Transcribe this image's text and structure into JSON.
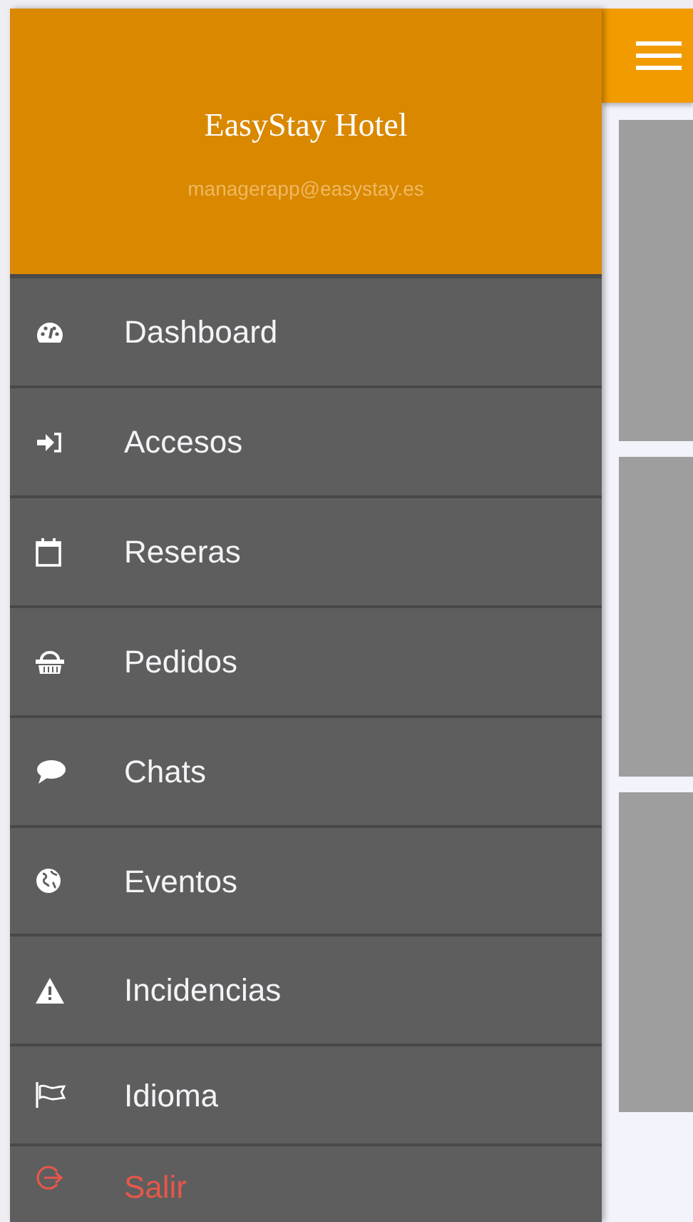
{
  "drawer": {
    "title": "EasyStay Hotel",
    "email": "managerapp@easystay.es",
    "items": [
      {
        "label": "Dashboard",
        "kind": "normal"
      },
      {
        "label": "Accesos",
        "kind": "normal"
      },
      {
        "label": "Reseras",
        "kind": "normal"
      },
      {
        "label": "Pedidos",
        "kind": "normal"
      },
      {
        "label": "Chats",
        "kind": "normal"
      },
      {
        "label": "Eventos",
        "kind": "normal"
      },
      {
        "label": "Incidencias",
        "kind": "normal"
      },
      {
        "label": "Idioma",
        "kind": "normal"
      },
      {
        "label": "Salir",
        "kind": "danger"
      }
    ]
  },
  "content": {
    "cards": [
      {
        "kind": "placeholder"
      },
      {
        "kind": "placeholder"
      },
      {
        "kind": "placeholder"
      }
    ]
  }
}
